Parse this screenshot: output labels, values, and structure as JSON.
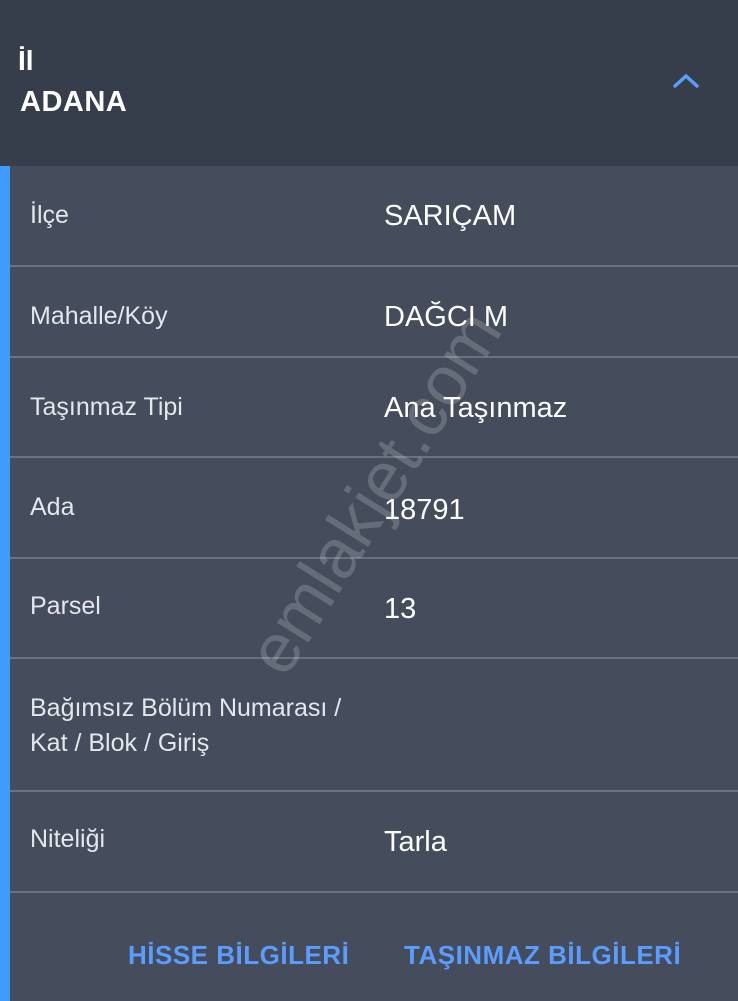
{
  "header": {
    "label": "İl",
    "value": "ADANA"
  },
  "rows": [
    {
      "label": "İlçe",
      "value": "SARIÇAM"
    },
    {
      "label": "Mahalle/Köy",
      "value": "DAĞCI M"
    },
    {
      "label": "Taşınmaz Tipi",
      "value": "Ana Taşınmaz"
    },
    {
      "label": "Ada",
      "value": "18791"
    },
    {
      "label": "Parsel",
      "value": "13"
    },
    {
      "label_line1": "Bağımsız Bölüm Numarası /",
      "label_line2": "Kat / Blok / Giriş",
      "value": ""
    },
    {
      "label": "Niteliği",
      "value": "Tarla"
    }
  ],
  "footer": {
    "share_info": "HİSSE BİLGİLERİ",
    "property_info": "TAŞINMAZ BİLGİLERİ"
  },
  "watermark": "emlakjet.com",
  "colors": {
    "header_bg": "#363d4b",
    "panel_bg": "#454c5b",
    "accent": "#3f9bff",
    "link": "#5b9dff"
  },
  "icons": {
    "collapse": "chevron-up-icon"
  }
}
